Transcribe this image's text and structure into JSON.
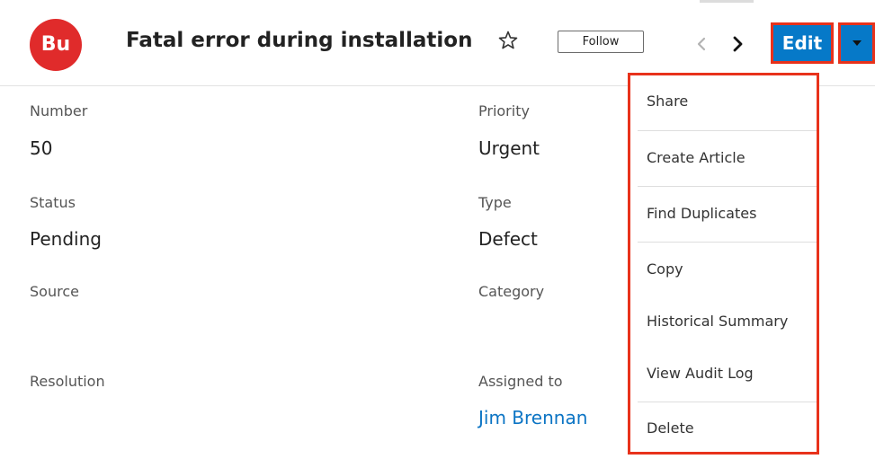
{
  "header": {
    "avatar_text": "Bu",
    "title": "Fatal error during installation",
    "follow_label": "Follow",
    "edit_label": "Edit",
    "avatar_color": "#e02b2b",
    "accent_color": "#0679c8",
    "highlight_color": "#e8321b"
  },
  "fields": {
    "number": {
      "label": "Number",
      "value": "50"
    },
    "priority": {
      "label": "Priority",
      "value": "Urgent"
    },
    "status": {
      "label": "Status",
      "value": "Pending"
    },
    "type": {
      "label": "Type",
      "value": "Defect"
    },
    "source": {
      "label": "Source",
      "value": ""
    },
    "category": {
      "label": "Category",
      "value": ""
    },
    "resolution": {
      "label": "Resolution",
      "value": ""
    },
    "assigned_to": {
      "label": "Assigned to",
      "value": "Jim Brennan"
    }
  },
  "actions_menu": {
    "items": [
      {
        "label": "Share"
      },
      {
        "label": "Create Article"
      },
      {
        "label": "Find Duplicates"
      },
      {
        "label": "Copy"
      },
      {
        "label": "Historical Summary"
      },
      {
        "label": "View Audit Log"
      },
      {
        "label": "Delete"
      }
    ]
  },
  "icons": {
    "favorite": "star-icon",
    "previous": "chevron-left-icon",
    "next": "chevron-right-icon",
    "actions": "caret-down-icon"
  }
}
